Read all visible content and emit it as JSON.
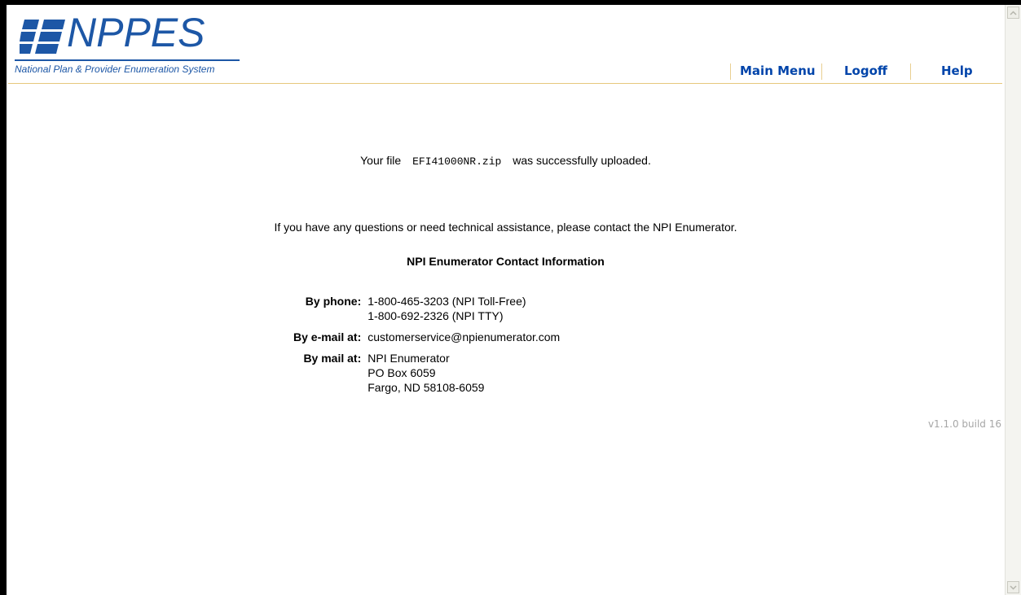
{
  "header": {
    "logo_text": "NPPES",
    "tagline": "National Plan & Provider Enumeration System",
    "nav": {
      "main_menu": "Main Menu",
      "logoff": "Logoff",
      "help": "Help"
    }
  },
  "upload": {
    "prefix": "Your file",
    "filename": "EFI41000NR.zip",
    "suffix": "was successfully uploaded."
  },
  "questions_text": "If you have any questions or need technical assistance, please contact the NPI Enumerator.",
  "contact": {
    "heading": "NPI Enumerator Contact Information",
    "phone_label": "By phone:",
    "phone_lines": [
      "1-800-465-3203 (NPI Toll-Free)",
      "1-800-692-2326 (NPI TTY)"
    ],
    "email_label": "By e-mail at:",
    "email": "customerservice@npienumerator.com",
    "mail_label": "By mail at:",
    "mail_lines": [
      "NPI Enumerator",
      "PO Box 6059",
      "Fargo, ND 58108-6059"
    ]
  },
  "version": "v1.1.0 build 16",
  "colors": {
    "brand_blue": "#1d57a6",
    "nav_blue": "#0044aa",
    "rule_gold": "#e6c77c"
  }
}
